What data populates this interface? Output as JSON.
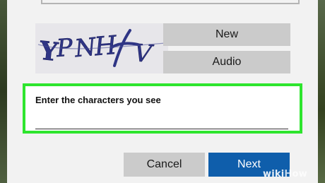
{
  "captcha": {
    "image_text": "YPNHV",
    "new_label": "New",
    "audio_label": "Audio"
  },
  "form": {
    "label": "Enter the characters you see",
    "value": ""
  },
  "actions": {
    "cancel_label": "Cancel",
    "next_label": "Next"
  },
  "watermark": {
    "wiki": "wiki",
    "how": "How"
  },
  "colors": {
    "highlight": "#2ee52e",
    "primary": "#0f5eab",
    "button_gray": "#cbcbcb"
  }
}
